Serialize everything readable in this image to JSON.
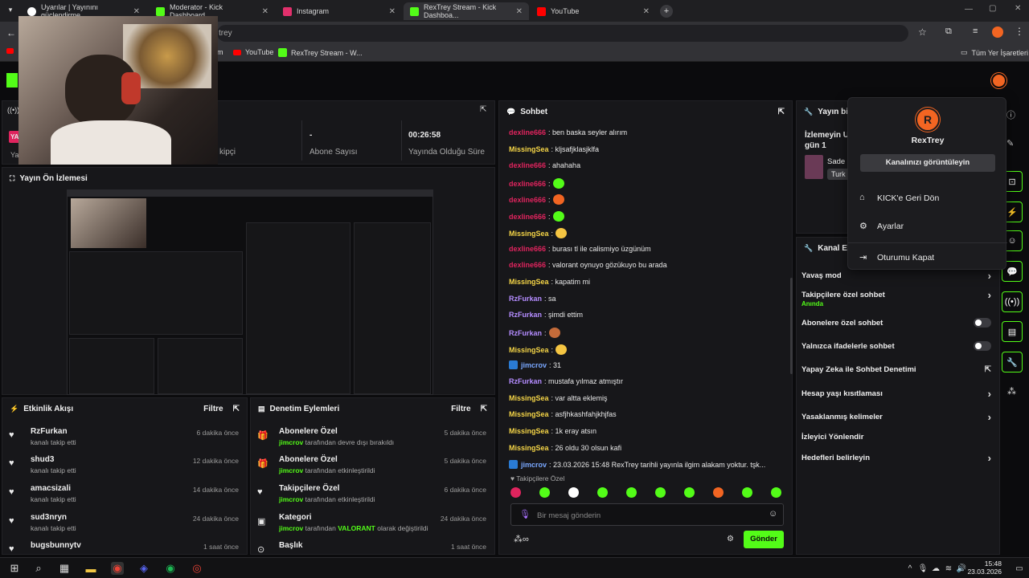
{
  "tabs": [
    {
      "label": "Uyarılar | Yayınını güçlendirme...",
      "color": "#fff"
    },
    {
      "label": "Moderator - Kick Dashboard",
      "color": "#53fc18"
    },
    {
      "label": "Instagram",
      "color": "#e1306c"
    },
    {
      "label": "RexTrey Stream - Kick Dashboa...",
      "color": "#53fc18"
    },
    {
      "label": "YouTube",
      "color": "#ff0000"
    }
  ],
  "address": {
    "url": "trey"
  },
  "bookmarks": {
    "item1": "m",
    "youtube": "YouTube",
    "rextrey": "RexTrey Stream - W...",
    "all": "Tüm Yer İşaretleri"
  },
  "stats": {
    "followers_label": "kipçi",
    "subs_value": "-",
    "subs_label": "Abone Sayısı",
    "uptime_value": "00:26:58",
    "uptime_label": "Yayında Olduğu Süre",
    "ya1": "YA",
    "ya2": "Ya"
  },
  "preview": {
    "title": "Yayın Ön İzlemesi"
  },
  "activity": {
    "title": "Etkinlik Akışı",
    "filter": "Filtre",
    "items": [
      {
        "name": "RzFurkan",
        "sub": "kanalı takip etti",
        "time": "6 dakika önce"
      },
      {
        "name": "shud3",
        "sub": "kanalı takip etti",
        "time": "12 dakika önce"
      },
      {
        "name": "amacsizali",
        "sub": "kanalı takip etti",
        "time": "14 dakika önce"
      },
      {
        "name": "sud3nryn",
        "sub": "kanalı takip etti",
        "time": "24 dakika önce"
      },
      {
        "name": "bugsbunnytv",
        "sub": "",
        "time": "1 saat önce"
      }
    ]
  },
  "modactions": {
    "title": "Denetim Eylemleri",
    "filter": "Filtre",
    "items": [
      {
        "title": "Abonelere Özel",
        "user": "jimcrov",
        "rest": " tarafından devre dışı bırakıldı",
        "time": "5 dakika önce"
      },
      {
        "title": "Abonelere Özel",
        "user": "jimcrov",
        "rest": " tarafından etkinleştirildi",
        "time": "5 dakika önce"
      },
      {
        "title": "Takipçilere Özel",
        "user": "jimcrov",
        "rest": " tarafından etkinleştirildi",
        "time": "6 dakika önce"
      },
      {
        "title": "Kategori",
        "user": "jimcrov",
        "rest": " tarafından ",
        "extra": "VALORANT",
        "rest2": " olarak değiştirildi",
        "time": "24 dakika önce"
      },
      {
        "title": "Başlık",
        "user": "",
        "rest": "",
        "time": "1 saat önce"
      }
    ]
  },
  "chat": {
    "title": "Sohbet",
    "placeholder": "Bir mesaj gönderin",
    "send": "Gönder",
    "followers_only": "Takipçilere Özel",
    "messages": [
      {
        "user": "dexline666",
        "color": "#e0245e",
        "text": ": ben baska seyler alırım"
      },
      {
        "user": "MissingSea",
        "color": "#f5d547",
        "text": ": kljsafjklasjklfa"
      },
      {
        "user": "dexline666",
        "color": "#e0245e",
        "text": ": ahahaha"
      },
      {
        "user": "dexline666",
        "color": "#e0245e",
        "text": ":",
        "emote": true
      },
      {
        "user": "dexline666",
        "color": "#e0245e",
        "text": ":",
        "emote": true
      },
      {
        "user": "dexline666",
        "color": "#e0245e",
        "text": ":",
        "emote": true
      },
      {
        "user": "MissingSea",
        "color": "#f5d547",
        "text": ":",
        "emote": true
      },
      {
        "user": "dexline666",
        "color": "#e0245e",
        "text": ": burası tl ile calismiyo üzgünüm"
      },
      {
        "user": "dexline666",
        "color": "#e0245e",
        "text": ": valorant oynuyo gözükuyo bu arada"
      },
      {
        "user": "MissingSea",
        "color": "#f5d547",
        "text": ": kapatim mi"
      },
      {
        "user": "RzFurkan",
        "color": "#b48cff",
        "text": ": sa"
      },
      {
        "user": "RzFurkan",
        "color": "#b48cff",
        "text": ": şimdi ettim"
      },
      {
        "user": "RzFurkan",
        "color": "#b48cff",
        "text": ":",
        "emote": true
      },
      {
        "user": "MissingSea",
        "color": "#f5d547",
        "text": ":",
        "emote": true
      },
      {
        "user": "jimcrov",
        "color": "#7aa8ff",
        "text": ": 31"
      },
      {
        "user": "RzFurkan",
        "color": "#b48cff",
        "text": ": mustafa yılmaz atmıştır"
      },
      {
        "user": "MissingSea",
        "color": "#f5d547",
        "text": ": var altta eklemiş"
      },
      {
        "user": "MissingSea",
        "color": "#f5d547",
        "text": ": asfjhkashfahjkhjfas"
      },
      {
        "user": "MissingSea",
        "color": "#f5d547",
        "text": ": 1k eray atsın"
      },
      {
        "user": "MissingSea",
        "color": "#f5d547",
        "text": ": 26 oldu 30 olsun kafi"
      },
      {
        "user": "jimcrov",
        "color": "#7aa8ff",
        "text": ": 23.03.2026 15:48 RexTrey tarihli yayınla ilgim alakam yoktur. tşk..."
      }
    ]
  },
  "info": {
    "title": "Yayın bilgi",
    "line1": "İzlemeyin U",
    "line2": "gün 1",
    "sade": "Sade",
    "turk": "Turk"
  },
  "channel": {
    "title": "Kanal Eyl",
    "actions": [
      {
        "label": "Yavaş mod",
        "type": "chev"
      },
      {
        "label": "Takipçilere özel sohbet",
        "sub": "Anında",
        "type": "chev"
      },
      {
        "label": "Abonelere özel sohbet",
        "type": "toggle"
      },
      {
        "label": "Yalnızca ifadelerle sohbet",
        "type": "toggle"
      },
      {
        "label": "Yapay Zeka ile Sohbet Denetimi",
        "type": "ext"
      },
      {
        "label": "Hesap yaşı kısıtlaması",
        "type": "chev"
      },
      {
        "label": "Yasaklanmış kelimeler",
        "type": "chev"
      },
      {
        "label": "İzleyici Yönlendir",
        "type": "none"
      },
      {
        "label": "Hedefleri belirleyin",
        "type": "chev"
      }
    ]
  },
  "menu": {
    "username": "RexTrey",
    "view_channel": "Kanalınızı görüntüleyin",
    "back": "KICK'e Geri Dön",
    "settings": "Ayarlar",
    "logout": "Oturumu Kapat"
  },
  "clock": {
    "time": "15:48",
    "date": "23.03.2026"
  },
  "colors": {
    "accent": "#53fc18",
    "panel": "#17171a",
    "bg": "#0b0b0d"
  }
}
